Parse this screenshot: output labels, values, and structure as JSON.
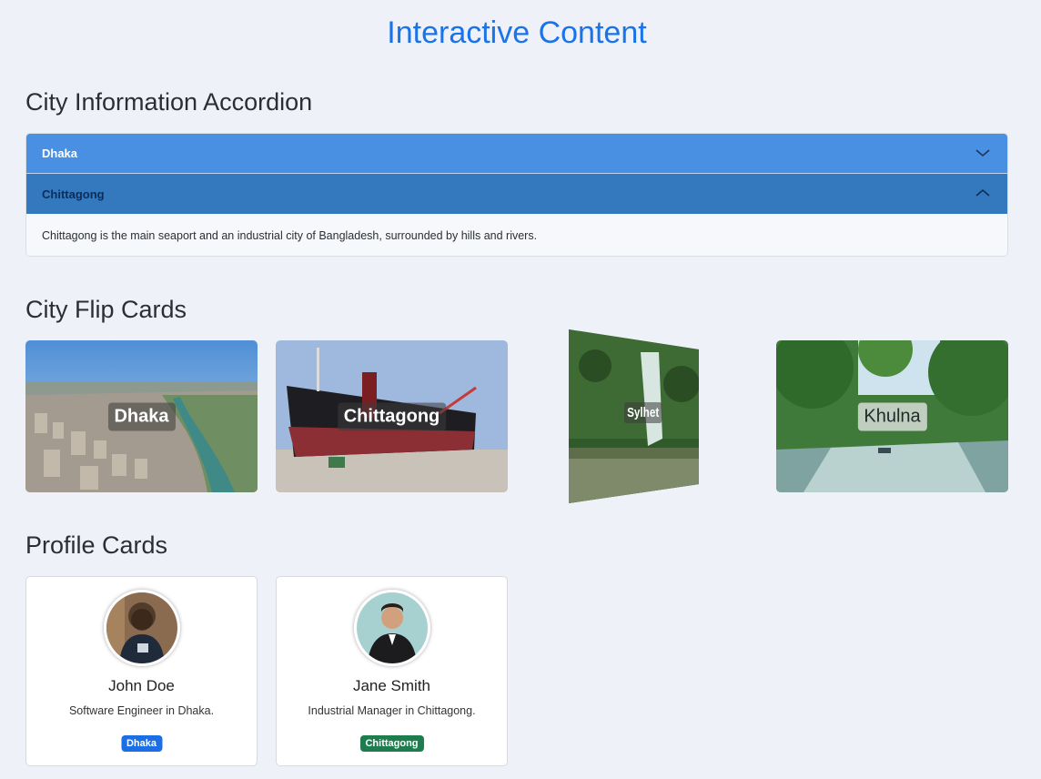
{
  "page_title": "Interactive Content",
  "sections": {
    "accordion_title": "City Information Accordion",
    "flip_title": "City Flip Cards",
    "profile_title": "Profile Cards"
  },
  "accordion": {
    "items": [
      {
        "label": "Dhaka",
        "expanded": false
      },
      {
        "label": "Chittagong",
        "expanded": true,
        "body": "Chittagong is the main seaport and an industrial city of Bangladesh, surrounded by hills and rivers."
      }
    ]
  },
  "flip_cards": [
    {
      "city": "Dhaka"
    },
    {
      "city": "Chittagong"
    },
    {
      "city": "Sylhet",
      "state": "flipping"
    },
    {
      "city": "Khulna"
    }
  ],
  "profiles": [
    {
      "name": "John Doe",
      "role": "Software Engineer in Dhaka.",
      "badge": "Dhaka",
      "badge_color": "#1a6fe6"
    },
    {
      "name": "Jane Smith",
      "role": "Industrial Manager in Chittagong.",
      "badge": "Chittagong",
      "badge_color": "#1e7d4f"
    }
  ],
  "colors": {
    "accent": "#1a73e8",
    "accordion_collapsed": "#4a90e2",
    "accordion_open": "#3478bd",
    "background": "#eef2f8"
  }
}
